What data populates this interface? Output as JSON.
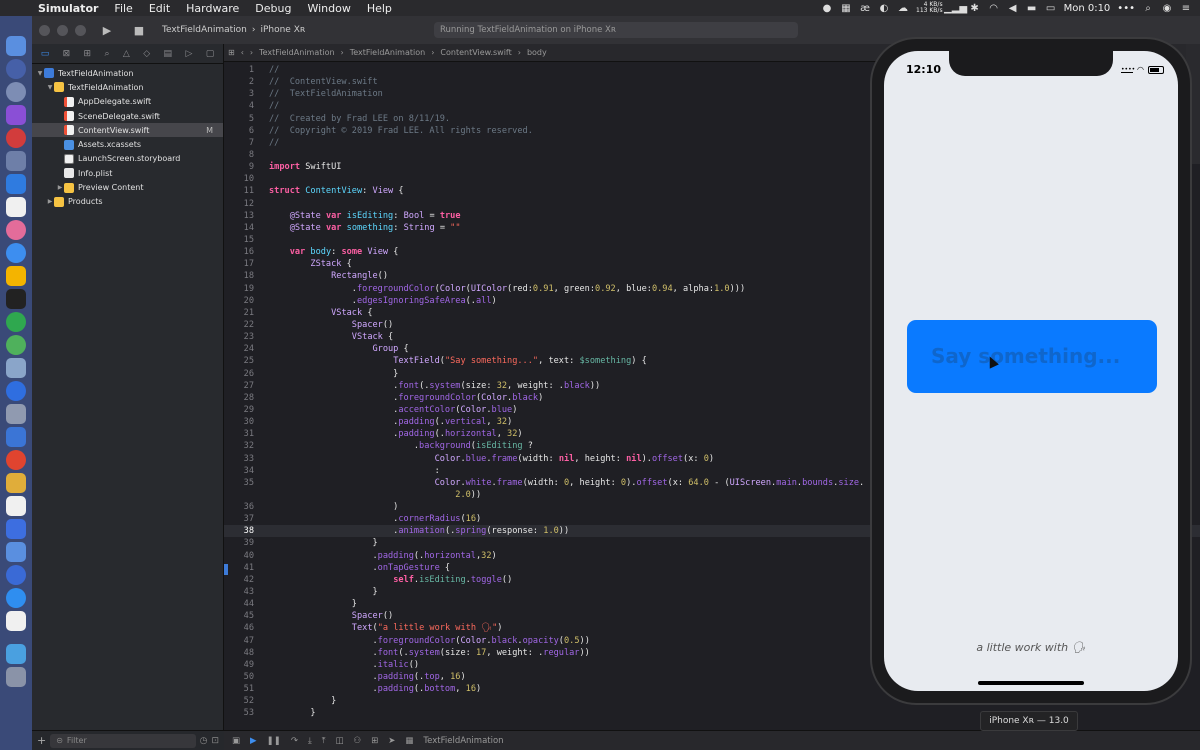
{
  "menubar": {
    "app": "Simulator",
    "items": [
      "File",
      "Edit",
      "Hardware",
      "Debug",
      "Window",
      "Help"
    ],
    "net_up": "4 KB/s",
    "net_down": "113 KB/s",
    "clock": "Mon 0:10",
    "more": "•••"
  },
  "toolbar": {
    "scheme": "TextFieldAnimation",
    "device": "iPhone Xʀ",
    "status": "Running TextFieldAnimation on iPhone Xʀ"
  },
  "navigator": {
    "items": [
      {
        "label": "TextFieldAnimation",
        "type": "xcproj",
        "indent": 0,
        "disclosure": "▼"
      },
      {
        "label": "TextFieldAnimation",
        "type": "folder",
        "indent": 1,
        "disclosure": "▼"
      },
      {
        "label": "AppDelegate.swift",
        "type": "swift",
        "indent": 2,
        "disclosure": ""
      },
      {
        "label": "SceneDelegate.swift",
        "type": "swift",
        "indent": 2,
        "disclosure": ""
      },
      {
        "label": "ContentView.swift",
        "type": "swift",
        "indent": 2,
        "disclosure": "",
        "selected": true,
        "badge": "M"
      },
      {
        "label": "Assets.xcassets",
        "type": "assets",
        "indent": 2,
        "disclosure": ""
      },
      {
        "label": "LaunchScreen.storyboard",
        "type": "storyboard",
        "indent": 2,
        "disclosure": ""
      },
      {
        "label": "Info.plist",
        "type": "plist",
        "indent": 2,
        "disclosure": ""
      },
      {
        "label": "Preview Content",
        "type": "folder",
        "indent": 2,
        "disclosure": "▶"
      },
      {
        "label": "Products",
        "type": "folder",
        "indent": 1,
        "disclosure": "▶"
      }
    ],
    "filter_placeholder": "Filter"
  },
  "jumpbar": [
    "TextFieldAnimation",
    "TextFieldAnimation",
    "ContentView.swift",
    "body"
  ],
  "code_lines": [
    "<span class=\"c\">//</span>",
    "<span class=\"c\">//  ContentView.swift</span>",
    "<span class=\"c\">//  TextFieldAnimation</span>",
    "<span class=\"c\">//</span>",
    "<span class=\"c\">//  Created by Frad LEE on 8/11/19.</span>",
    "<span class=\"c\">//  Copyright © 2019 Frad LEE. All rights reserved.</span>",
    "<span class=\"c\">//</span>",
    "",
    "<span class=\"k\">import</span> SwiftUI",
    "",
    "<span class=\"k\">struct</span> <span class=\"ty\">ContentView</span>: <span class=\"t\">View</span> {",
    "",
    "    <span class=\"t\">@State</span> <span class=\"k\">var</span> <span class=\"ty\">isEditing</span>: <span class=\"t\">Bool</span> = <span class=\"k\">true</span>",
    "    <span class=\"t\">@State</span> <span class=\"k\">var</span> <span class=\"ty\">something</span>: <span class=\"t\">String</span> = <span class=\"s\">\"\"</span>",
    "",
    "    <span class=\"k\">var</span> <span class=\"ty\">body</span>: <span class=\"k\">some</span> <span class=\"t\">View</span> {",
    "        <span class=\"t\">ZStack</span> {",
    "            <span class=\"t\">Rectangle</span>()",
    "                .<span class=\"f\">foregroundColor</span>(<span class=\"t\">Color</span>(<span class=\"t\">UIColor</span>(red:<span class=\"n\">0.91</span>, green:<span class=\"n\">0.92</span>, blue:<span class=\"n\">0.94</span>, alpha:<span class=\"n\">1.0</span>)))",
    "                .<span class=\"f\">edgesIgnoringSafeArea</span>(.<span class=\"f\">all</span>)",
    "            <span class=\"t\">VStack</span> {",
    "                <span class=\"t\">Spacer</span>()",
    "                <span class=\"t\">VStack</span> {",
    "                    <span class=\"t\">Group</span> {",
    "                        <span class=\"t\">TextField</span>(<span class=\"s\">\"Say something...\"</span>, text: <span class=\"p\">$something</span>) {",
    "                        }",
    "                        .<span class=\"f\">font</span>(.<span class=\"f\">system</span>(size: <span class=\"n\">32</span>, weight: .<span class=\"f\">black</span>))",
    "                        .<span class=\"f\">foregroundColor</span>(<span class=\"t\">Color</span>.<span class=\"f\">black</span>)",
    "                        .<span class=\"f\">accentColor</span>(<span class=\"t\">Color</span>.<span class=\"f\">blue</span>)",
    "                        .<span class=\"f\">padding</span>(.<span class=\"f\">vertical</span>, <span class=\"n\">32</span>)",
    "                        .<span class=\"f\">padding</span>(.<span class=\"f\">horizontal</span>, <span class=\"n\">32</span>)",
    "                            .<span class=\"f\">background</span>(<span class=\"p\">isEditing</span> ?",
    "                                <span class=\"t\">Color</span>.<span class=\"f\">blue</span>.<span class=\"f\">frame</span>(width: <span class=\"k\">nil</span>, height: <span class=\"k\">nil</span>).<span class=\"f\">offset</span>(x: <span class=\"n\">0</span>)",
    "                                :",
    "                                <span class=\"t\">Color</span>.<span class=\"f\">white</span>.<span class=\"f\">frame</span>(width: <span class=\"n\">0</span>, height: <span class=\"n\">0</span>).<span class=\"f\">offset</span>(x: <span class=\"n\">64.0</span> - (<span class=\"t\">UIScreen</span>.<span class=\"f\">main</span>.<span class=\"f\">bounds</span>.<span class=\"f\">size</span>.",
    "                                    <span class=\"n\">2.0</span>))",
    "                        )",
    "                        .<span class=\"f\">cornerRadius</span>(<span class=\"n\">16</span>)",
    "                        .<span class=\"f\">animation</span>(.<span class=\"f\">spring</span>(response: <span class=\"n\">1.0</span>))",
    "                    }",
    "                    .<span class=\"f\">padding</span>(.<span class=\"f\">horizontal</span>,<span class=\"n\">32</span>)",
    "                    .<span class=\"f\">onTapGesture</span> {",
    "                        <span class=\"k\">self</span>.<span class=\"p\">isEditing</span>.<span class=\"f\">toggle</span>()",
    "                    }",
    "                }",
    "                <span class=\"t\">Spacer</span>()",
    "                <span class=\"t\">Text</span>(<span class=\"s\">\"a little work with 🗣\"</span>)",
    "                    .<span class=\"f\">foregroundColor</span>(<span class=\"t\">Color</span>.<span class=\"f\">black</span>.<span class=\"f\">opacity</span>(<span class=\"n\">0.5</span>))",
    "                    .<span class=\"f\">font</span>(.<span class=\"f\">system</span>(size: <span class=\"n\">17</span>, weight: .<span class=\"f\">regular</span>))",
    "                    .<span class=\"f\">italic</span>()",
    "                    .<span class=\"f\">padding</span>(.<span class=\"f\">top</span>, <span class=\"n\">16</span>)",
    "                    .<span class=\"f\">padding</span>(.<span class=\"f\">bottom</span>, <span class=\"n\">16</span>)",
    "            }",
    "        }"
  ],
  "line_numbers": [
    "1",
    "2",
    "3",
    "4",
    "5",
    "6",
    "7",
    "8",
    "9",
    "10",
    "11",
    "12",
    "13",
    "14",
    "15",
    "16",
    "17",
    "18",
    "19",
    "20",
    "21",
    "22",
    "23",
    "24",
    "25",
    "26",
    "27",
    "28",
    "29",
    "30",
    "31",
    "32",
    "33",
    "34",
    "35",
    "",
    "36",
    "37",
    "38",
    "39",
    "40",
    "41",
    "42",
    "43",
    "44",
    "45",
    "46",
    "47",
    "48",
    "49",
    "50",
    "51",
    "52",
    "53"
  ],
  "current_line": "38",
  "debugbar_target": "TextFieldAnimation",
  "simulator": {
    "time": "12:10",
    "textfield_placeholder": "Say something...",
    "footer_text": "a little work with 🗣",
    "device_label": "iPhone Xʀ — 13.0"
  },
  "colors": {
    "accent": "#0a7aff",
    "sim_background": "#e8ebf0",
    "dock": "#3a4a78"
  }
}
